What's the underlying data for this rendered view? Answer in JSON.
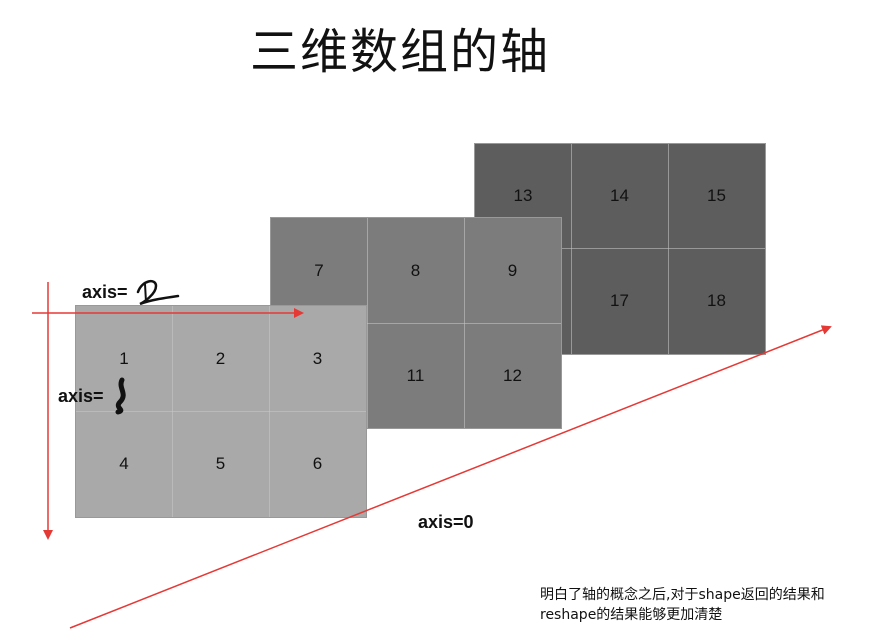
{
  "title": "三维数组的轴",
  "back_slab": {
    "cells": [
      "13",
      "14",
      "15",
      "",
      "17",
      "18"
    ]
  },
  "middle_slab": {
    "cells": [
      "7",
      "8",
      "9",
      "",
      "11",
      "12"
    ]
  },
  "front_slab": {
    "cells": [
      "1",
      "2",
      "3",
      "4",
      "5",
      "6"
    ]
  },
  "axes": {
    "axis0_label": "axis=0",
    "axis1_label": "axis=",
    "axis2_label": "axis=",
    "arrow_color": "#e53935"
  },
  "note": "明白了轴的概念之后,对于shape返回的结果和reshape的结果能够更加清楚"
}
